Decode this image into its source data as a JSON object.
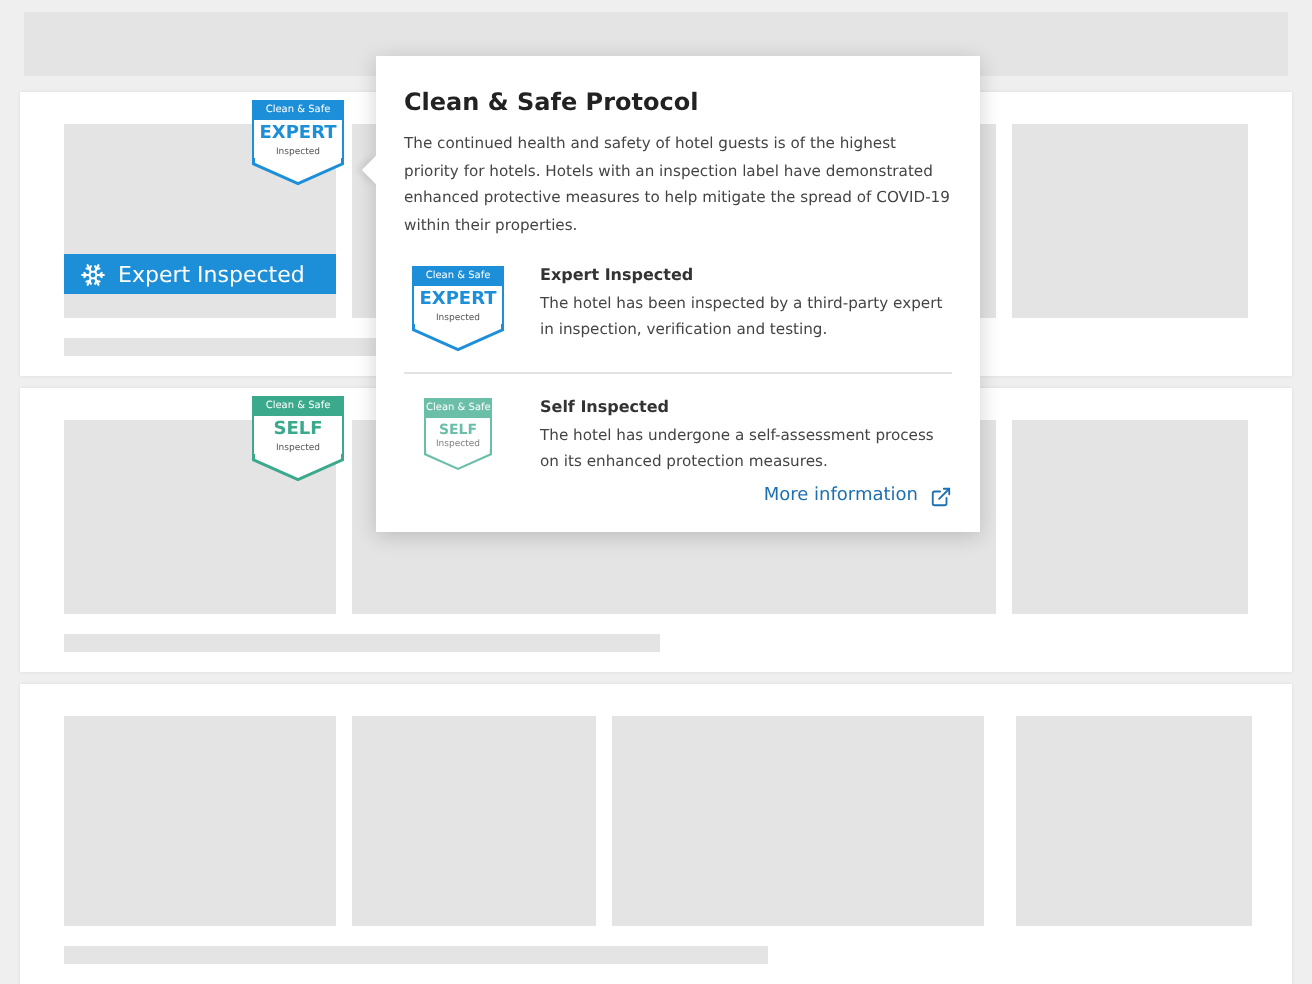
{
  "listings": [
    {
      "badge": {
        "kind": "expert",
        "top": "Clean & Safe",
        "main": "EXPERT",
        "bottom": "Inspected"
      },
      "button": "Expert Inspected"
    },
    {
      "badge": {
        "kind": "self",
        "top": "Clean & Safe",
        "main": "SELF",
        "bottom": "Inspected"
      }
    }
  ],
  "popover": {
    "title": "Clean & Safe Protocol",
    "body": "The continued health and safety of hotel guests is of the highest priority for hotels. Hotels with an inspection label have demonstrated enhanced protective measures to help mitigate the spread of COVID-19 within their properties.",
    "items": [
      {
        "kind": "expert",
        "badge": {
          "top": "Clean & Safe",
          "main": "EXPERT",
          "bottom": "Inspected"
        },
        "title": "Expert Inspected",
        "text": "The hotel has been inspected by a third-party expert in inspection, verification and testing."
      },
      {
        "kind": "self",
        "badge": {
          "top": "Clean & Safe",
          "main": "SELF",
          "bottom": "Inspected"
        },
        "title": "Self Inspected",
        "text": "The hotel has undergone a self-assessment process on its enhanced protection measures."
      }
    ],
    "link": "More information"
  }
}
